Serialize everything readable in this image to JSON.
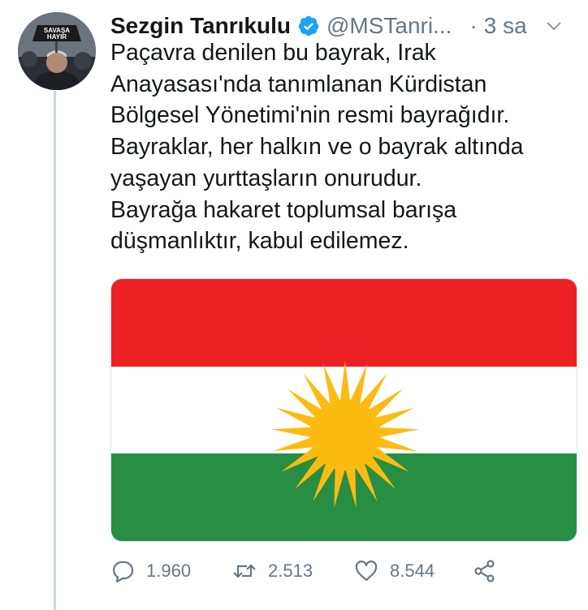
{
  "tweet": {
    "author": {
      "name": "Sezgin Tanrıkulu",
      "handle": "@MSTanri...",
      "verified": true,
      "avatar_sign_text": [
        "SAVAŞA",
        "HAYIR"
      ]
    },
    "separator": "·",
    "timestamp": "3 sa",
    "text_lines": [
      "Paçavra denilen bu bayrak, Irak",
      "Anayasası'nda tanımlanan Kürdistan",
      "Bölgesel Yönetimi'nin resmi bayrağıdır.",
      "Bayraklar, her halkın ve o bayrak altında",
      "yaşayan yurttaşların onurudur.",
      "Bayrağa hakaret toplumsal barışa",
      "düşmanlıktır, kabul edilemez."
    ],
    "media": {
      "type": "flag-image",
      "colors": {
        "red": "#ed2024",
        "white": "#ffffff",
        "green": "#278e43",
        "sun": "#fdbb12"
      }
    },
    "actions": {
      "replies": "1.960",
      "retweets": "2.513",
      "likes": "8.544"
    },
    "icons": {
      "verified": "verified-badge-icon",
      "chevron": "chevron-down-icon",
      "reply": "reply-icon",
      "retweet": "retweet-icon",
      "like": "heart-icon",
      "share": "share-icon"
    },
    "accent_color": "#1da1f2"
  }
}
